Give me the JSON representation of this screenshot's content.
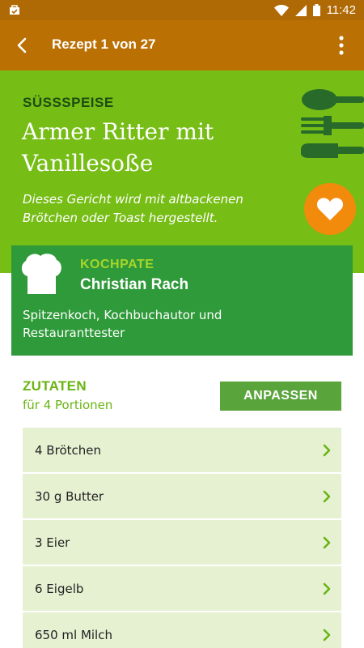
{
  "status_bar": {
    "time": "11:42"
  },
  "app_bar": {
    "title": "Rezept 1 von 27"
  },
  "recipe": {
    "category": "SÜSSSPEISE",
    "title": "Armer Ritter mit Vanillesoße",
    "description": "Dieses Gericht wird mit altbackenen Brötchen oder Toast hergestellt."
  },
  "chef": {
    "label": "KOCHPATE",
    "name": "Christian Rach",
    "description": "Spitzenkoch, Kochbuchautor und Restauranttester"
  },
  "ingredients": {
    "label": "ZUTATEN",
    "portions": "für 4 Portionen",
    "adjust_label": "ANPASSEN",
    "items": [
      "4 Brötchen",
      "30 g Butter",
      "3 Eier",
      "6 Eigelb",
      "650 ml Milch"
    ]
  },
  "colors": {
    "status_bar": "#b06a05",
    "app_bar": "#bb7004",
    "hero": "#76bd16",
    "chef_card": "#2f9a3a",
    "favorite": "#f28a0c",
    "accent": "#6ab414",
    "row_bg": "#e6f1d2"
  },
  "icons": {
    "status_left": "notification-bag-icon",
    "wifi": "wifi-icon",
    "signal": "signal-icon",
    "battery": "battery-icon",
    "back": "arrow-back-icon",
    "more": "more-vert-icon",
    "cutlery": "cutlery-icon",
    "favorite": "heart-icon",
    "chef": "chef-hat-icon",
    "row": "chevron-right-icon"
  }
}
